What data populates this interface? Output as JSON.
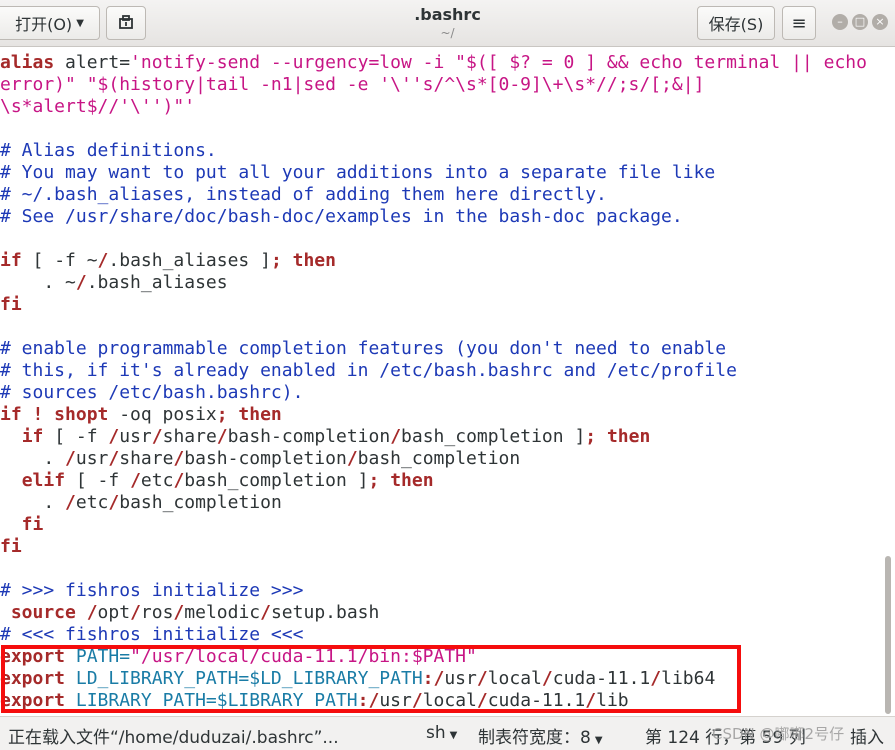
{
  "header": {
    "open_label": "打开(O)",
    "recent_icon": "document-pin-icon",
    "title": ".bashrc",
    "subtitle": "~/",
    "save_label": "保存(S)",
    "menu_icon": "hamburger-menu-icon"
  },
  "editor": {
    "lines": [
      [
        {
          "t": "alias",
          "c": "kw"
        },
        {
          "t": " alert="
        },
        {
          "t": "'notify-send --urgency=low -i \"$([ $? = 0 ] && echo terminal || echo",
          "c": "str"
        }
      ],
      [
        {
          "t": "error)\" \"$(history|tail -n1|sed -e '\\''s/^\\s*[0-9]\\+\\s*//;s/[;&|]",
          "c": "str"
        }
      ],
      [
        {
          "t": "\\s*alert$//'\\'')\"'",
          "c": "str"
        }
      ],
      [],
      [
        {
          "t": "# Alias definitions.",
          "c": "comment"
        }
      ],
      [
        {
          "t": "# You may want to put all your additions into a separate file like",
          "c": "comment"
        }
      ],
      [
        {
          "t": "# ~/.bash_aliases, instead of adding them here directly.",
          "c": "comment"
        }
      ],
      [
        {
          "t": "# See /usr/share/doc/bash-doc/examples in the bash-doc package.",
          "c": "comment"
        }
      ],
      [],
      [
        {
          "t": "if",
          "c": "kw"
        },
        {
          "t": " [ -f ~"
        },
        {
          "t": "/",
          "c": "path"
        },
        {
          "t": ".bash_aliases ]"
        },
        {
          "t": "; then",
          "c": "kw"
        }
      ],
      [
        {
          "t": "    . ~"
        },
        {
          "t": "/",
          "c": "path"
        },
        {
          "t": ".bash_aliases"
        }
      ],
      [
        {
          "t": "fi",
          "c": "kw"
        }
      ],
      [],
      [
        {
          "t": "# enable programmable completion features (you don't need to enable",
          "c": "comment"
        }
      ],
      [
        {
          "t": "# this, if it's already enabled in /etc/bash.bashrc and /etc/profile",
          "c": "comment"
        }
      ],
      [
        {
          "t": "# sources /etc/bash.bashrc).",
          "c": "comment"
        }
      ],
      [
        {
          "t": "if ! shopt",
          "c": "kw"
        },
        {
          "t": " -oq posix"
        },
        {
          "t": "; then",
          "c": "kw"
        }
      ],
      [
        {
          "t": "  "
        },
        {
          "t": "if",
          "c": "kw"
        },
        {
          "t": " [ -f "
        },
        {
          "t": "/",
          "c": "path"
        },
        {
          "t": "usr"
        },
        {
          "t": "/",
          "c": "path"
        },
        {
          "t": "share"
        },
        {
          "t": "/",
          "c": "path"
        },
        {
          "t": "bash-completion"
        },
        {
          "t": "/",
          "c": "path"
        },
        {
          "t": "bash_completion ]"
        },
        {
          "t": "; then",
          "c": "kw"
        }
      ],
      [
        {
          "t": "    . "
        },
        {
          "t": "/",
          "c": "path"
        },
        {
          "t": "usr"
        },
        {
          "t": "/",
          "c": "path"
        },
        {
          "t": "share"
        },
        {
          "t": "/",
          "c": "path"
        },
        {
          "t": "bash-completion"
        },
        {
          "t": "/",
          "c": "path"
        },
        {
          "t": "bash_completion"
        }
      ],
      [
        {
          "t": "  "
        },
        {
          "t": "elif",
          "c": "kw"
        },
        {
          "t": " [ -f "
        },
        {
          "t": "/",
          "c": "path"
        },
        {
          "t": "etc"
        },
        {
          "t": "/",
          "c": "path"
        },
        {
          "t": "bash_completion ]"
        },
        {
          "t": "; then",
          "c": "kw"
        }
      ],
      [
        {
          "t": "    . "
        },
        {
          "t": "/",
          "c": "path"
        },
        {
          "t": "etc"
        },
        {
          "t": "/",
          "c": "path"
        },
        {
          "t": "bash_completion"
        }
      ],
      [
        {
          "t": "  fi",
          "c": "kw"
        }
      ],
      [
        {
          "t": "fi",
          "c": "kw"
        }
      ],
      [],
      [
        {
          "t": "# >>> fishros initialize >>>",
          "c": "comment"
        }
      ],
      [
        {
          "t": " source",
          "c": "kw"
        },
        {
          "t": " "
        },
        {
          "t": "/",
          "c": "path"
        },
        {
          "t": "opt"
        },
        {
          "t": "/",
          "c": "path"
        },
        {
          "t": "ros"
        },
        {
          "t": "/",
          "c": "path"
        },
        {
          "t": "melodic"
        },
        {
          "t": "/",
          "c": "path"
        },
        {
          "t": "setup.bash"
        }
      ],
      [
        {
          "t": "# <<< fishros initialize <<<",
          "c": "comment"
        }
      ],
      [
        {
          "t": "export",
          "c": "kw"
        },
        {
          "t": " PATH=",
          "c": "var"
        },
        {
          "t": "\"/usr/local/cuda-11.1/bin:$PATH\"",
          "c": "str"
        }
      ],
      [
        {
          "t": "export",
          "c": "kw"
        },
        {
          "t": " LD_LIBRARY_PATH=$LD_LIBRARY_PATH",
          "c": "var"
        },
        {
          "t": ":/",
          "c": "path"
        },
        {
          "t": "usr"
        },
        {
          "t": "/",
          "c": "path"
        },
        {
          "t": "local"
        },
        {
          "t": "/",
          "c": "path"
        },
        {
          "t": "cuda-11.1"
        },
        {
          "t": "/",
          "c": "path"
        },
        {
          "t": "lib64"
        }
      ],
      [
        {
          "t": "export",
          "c": "kw"
        },
        {
          "t": " LIBRARY_PATH=$LIBRARY_PATH",
          "c": "var"
        },
        {
          "t": ":/",
          "c": "path"
        },
        {
          "t": "usr"
        },
        {
          "t": "/",
          "c": "path"
        },
        {
          "t": "local"
        },
        {
          "t": "/",
          "c": "path"
        },
        {
          "t": "cuda-11.1"
        },
        {
          "t": "/",
          "c": "path"
        },
        {
          "t": "lib"
        }
      ]
    ]
  },
  "statusbar": {
    "loading_text": "正在载入文件“/home/duduzai/.bashrc”...",
    "language": "sh",
    "tab_width": "制表符宽度：8",
    "position": "第 124 行，第 59 列",
    "mode": "插入"
  },
  "watermark": "CSDN @嘟嘟2号仔"
}
